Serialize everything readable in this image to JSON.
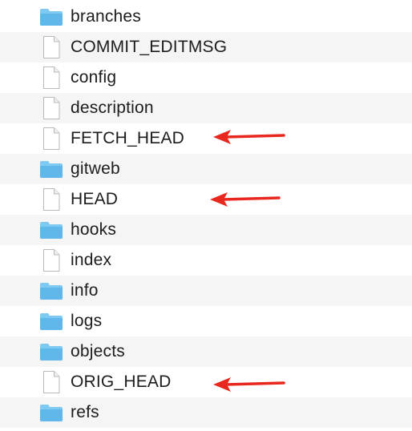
{
  "items": [
    {
      "name": "branches",
      "kind": "folder",
      "icon": "folder-icon"
    },
    {
      "name": "COMMIT_EDITMSG",
      "kind": "file",
      "icon": "document-icon"
    },
    {
      "name": "config",
      "kind": "file",
      "icon": "document-icon"
    },
    {
      "name": "description",
      "kind": "file",
      "icon": "document-icon"
    },
    {
      "name": "FETCH_HEAD",
      "kind": "file",
      "icon": "document-icon",
      "highlighted": true
    },
    {
      "name": "gitweb",
      "kind": "folder",
      "icon": "folder-icon"
    },
    {
      "name": "HEAD",
      "kind": "file",
      "icon": "document-icon",
      "highlighted": true
    },
    {
      "name": "hooks",
      "kind": "folder",
      "icon": "folder-icon"
    },
    {
      "name": "index",
      "kind": "file",
      "icon": "document-icon"
    },
    {
      "name": "info",
      "kind": "folder",
      "icon": "folder-icon"
    },
    {
      "name": "logs",
      "kind": "folder",
      "icon": "folder-icon"
    },
    {
      "name": "objects",
      "kind": "folder",
      "icon": "folder-icon"
    },
    {
      "name": "ORIG_HEAD",
      "kind": "file",
      "icon": "document-icon",
      "highlighted": true
    },
    {
      "name": "refs",
      "kind": "folder",
      "icon": "folder-icon"
    }
  ],
  "colors": {
    "folder": "#5fb7ea",
    "folder_tab": "#7fcaf2",
    "arrow": "#e8281e",
    "row_alt": "#f5f5f5",
    "text": "#1d1d1d"
  }
}
